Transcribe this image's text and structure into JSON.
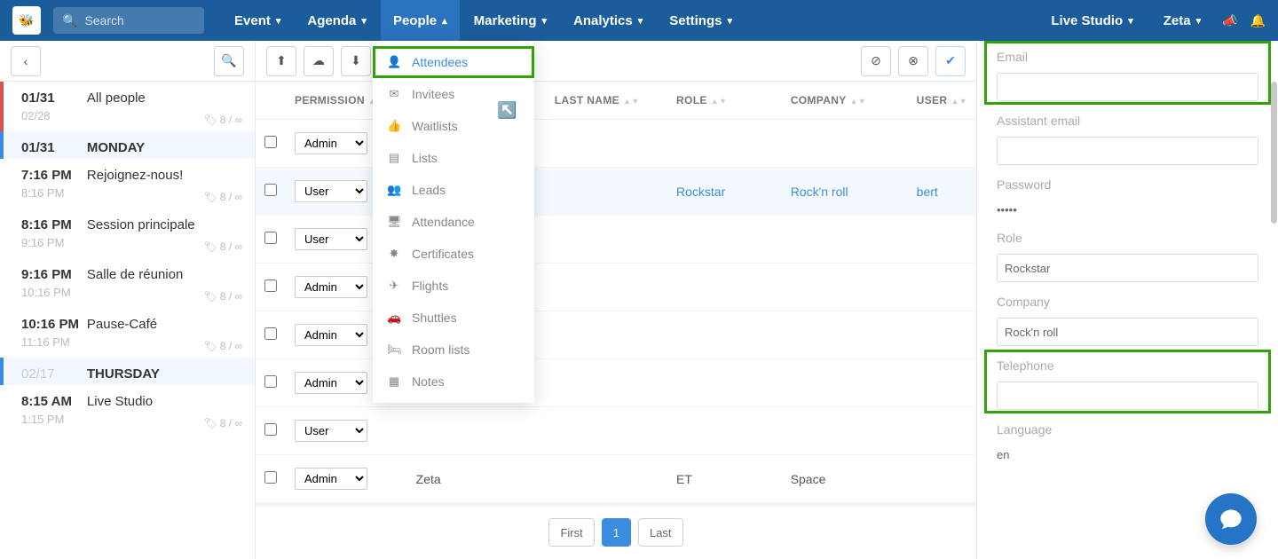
{
  "search_placeholder": "Search",
  "nav": {
    "event": "Event",
    "agenda": "Agenda",
    "people": "People",
    "marketing": "Marketing",
    "analytics": "Analytics",
    "settings": "Settings",
    "live_studio": "Live Studio",
    "zeta": "Zeta"
  },
  "left": {
    "r0_date": "01/31",
    "r0_title": "All people",
    "r0_sub": "02/28",
    "r0_tag": "8 / ∞",
    "r1_date": "01/31",
    "r1_title": "MONDAY",
    "r2_date": "7:16 PM",
    "r2_title": "Rejoignez-nous!",
    "r2_sub": "8:16 PM",
    "r2_tag": "8 / ∞",
    "r3_date": "8:16 PM",
    "r3_title": "Session principale",
    "r3_sub": "9:16 PM",
    "r3_tag": "8 / ∞",
    "r4_date": "9:16 PM",
    "r4_title": "Salle de réunion",
    "r4_sub": "10:16 PM",
    "r4_tag": "8 / ∞",
    "r5_date": "10:16 PM",
    "r5_title": "Pause-Café",
    "r5_sub": "11:16 PM",
    "r5_tag": "8 / ∞",
    "r6_date": "02/17",
    "r6_title": "THURSDAY",
    "r7_date": "8:15 AM",
    "r7_title": "Live Studio",
    "r7_sub": "1:15 PM",
    "r7_tag": "8 / ∞"
  },
  "dropdown": {
    "attendees": "Attendees",
    "invitees": "Invitees",
    "waitlists": "Waitlists",
    "lists": "Lists",
    "leads": "Leads",
    "attendance": "Attendance",
    "certificates": "Certificates",
    "flights": "Flights",
    "shuttles": "Shuttles",
    "roomlists": "Room lists",
    "notes": "Notes"
  },
  "table": {
    "h_permission": "PERMISSION",
    "h_lastname": "LAST NAME",
    "h_role": "ROLE",
    "h_company": "COMPANY",
    "h_user": "USER",
    "perm_admin": "Admin",
    "perm_user": "User",
    "r1_p": "Admin",
    "r2_p": "User",
    "r2_role": "Rockstar",
    "r2_company": "Rock'n roll",
    "r2_user": "bert",
    "r3_p": "User",
    "r4_p": "Admin",
    "r5_p": "Admin",
    "r6_p": "Admin",
    "r7_p": "User",
    "r8_p": "Admin",
    "r8_fn": "Zeta",
    "r8_role": "ET",
    "r8_company": "Space"
  },
  "pager": {
    "first": "First",
    "one": "1",
    "last": "Last"
  },
  "form": {
    "email_label": "Email",
    "email_val": "",
    "assistant_label": "Assistant email",
    "assistant_val": "",
    "password_label": "Password",
    "password_val": "*****",
    "role_label": "Role",
    "role_val": "Rockstar",
    "company_label": "Company",
    "company_val": "Rock'n roll",
    "telephone_label": "Telephone",
    "telephone_val": "",
    "language_label": "Language",
    "language_val": "en"
  }
}
